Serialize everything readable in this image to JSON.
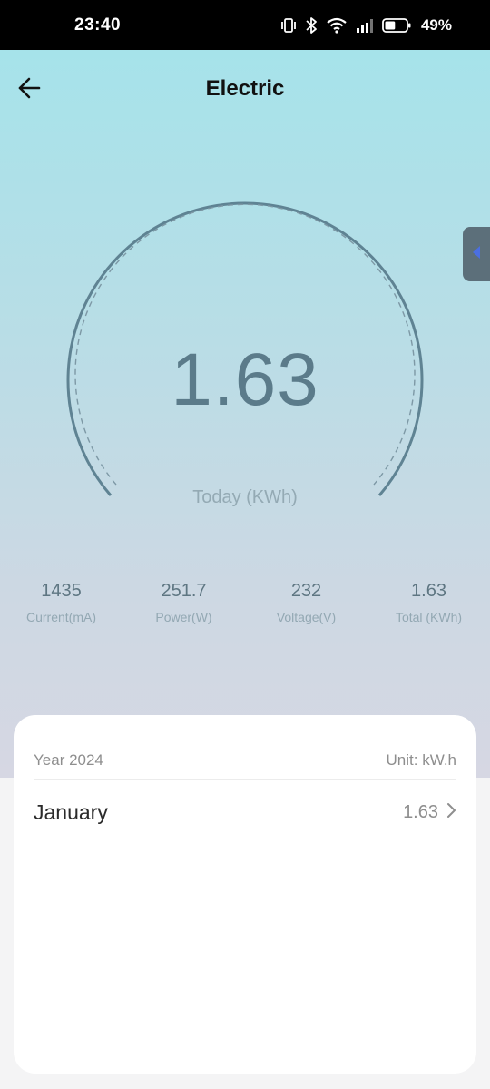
{
  "status_bar": {
    "time": "23:40",
    "battery_percent": "49%",
    "battery_level": 0.49,
    "icons": [
      "vibrate-icon",
      "bluetooth-icon",
      "wifi-icon",
      "cellular-signal-icon",
      "battery-icon"
    ]
  },
  "header": {
    "title": "Electric",
    "back_icon": "arrow-left-icon"
  },
  "side_tab": {
    "icon": "triangle-left-icon",
    "icon_color": "#4b6fe0"
  },
  "gauge": {
    "value": "1.63",
    "caption": "Today (KWh)",
    "arc_color": "#5f8393"
  },
  "stats": [
    {
      "value": "1435",
      "label": "Current(mA)"
    },
    {
      "value": "251.7",
      "label": "Power(W)"
    },
    {
      "value": "232",
      "label": "Voltage(V)"
    },
    {
      "value": "1.63",
      "label": "Total (KWh)"
    }
  ],
  "card": {
    "year_label": "Year 2024",
    "unit_label": "Unit: kW.h",
    "rows": [
      {
        "month": "January",
        "value": "1.63",
        "icon": "chevron-right-icon"
      }
    ]
  }
}
